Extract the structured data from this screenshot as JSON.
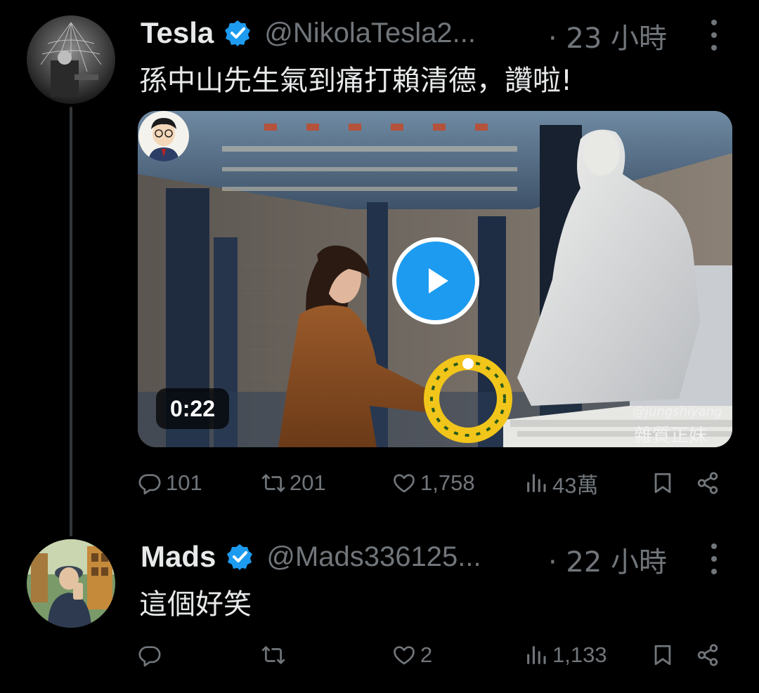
{
  "colors": {
    "background": "#000000",
    "primary_text": "#e7e9ea",
    "secondary_text": "#71767b",
    "accent": "#1d9bf0",
    "thread_line": "#333639"
  },
  "tweets": [
    {
      "author": "Tesla",
      "verified": true,
      "handle": "@NikolaTesla2...",
      "time": "· 23 小時",
      "text": "孫中山先生氣到痛打賴清德，讚啦!",
      "media": {
        "type": "video",
        "duration": "0:22",
        "watermark_handle": "@jungshiyang",
        "watermark_text": "雜質正妹"
      },
      "actions": {
        "replies": "101",
        "retweets": "201",
        "likes": "1,758",
        "views": "43萬"
      }
    },
    {
      "author": "Mads",
      "verified": true,
      "handle": "@Mads336125...",
      "time": "· 22 小時",
      "text": "這個好笑",
      "actions": {
        "replies": "",
        "retweets": "",
        "likes": "2",
        "views": "1,133"
      }
    }
  ],
  "icons": [
    "verified-badge-icon",
    "more-options-icon",
    "reply-icon",
    "retweet-icon",
    "like-icon",
    "views-icon",
    "bookmark-icon",
    "share-icon",
    "play-icon"
  ]
}
